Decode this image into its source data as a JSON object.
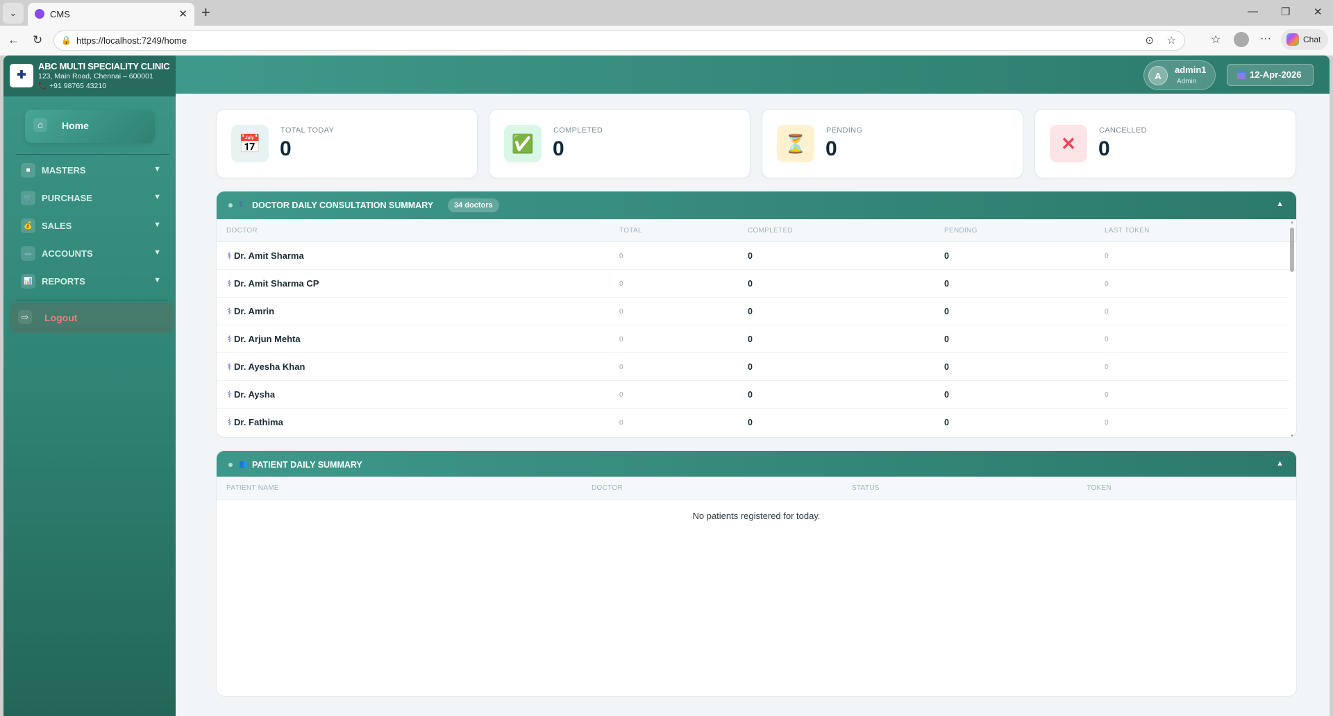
{
  "browser": {
    "tab_title": "CMS",
    "url": "https://localhost:7249/home",
    "chat_label": "Chat"
  },
  "clinic": {
    "name": "ABC MULTI SPECIALITY CLINIC",
    "address": "123, Main Road, Chennai – 600001",
    "phone": "+91 98765 43210"
  },
  "sidebar": {
    "home": "Home",
    "items": [
      {
        "label": "MASTERS",
        "icon": "folder-icon"
      },
      {
        "label": "PURCHASE",
        "icon": "cart-icon"
      },
      {
        "label": "SALES",
        "icon": "money-bag-icon"
      },
      {
        "label": "ACCOUNTS",
        "icon": "credit-card-icon"
      },
      {
        "label": "REPORTS",
        "icon": "bar-chart-icon"
      }
    ],
    "logout": "Logout"
  },
  "header": {
    "user_initial": "A",
    "user_name": "admin1",
    "user_role": "Admin",
    "date": "12-Apr-2026"
  },
  "stats": [
    {
      "label": "TOTAL TODAY",
      "value": "0",
      "icon": "calendar-icon"
    },
    {
      "label": "COMPLETED",
      "value": "0",
      "icon": "check-icon"
    },
    {
      "label": "PENDING",
      "value": "0",
      "icon": "hourglass-icon"
    },
    {
      "label": "CANCELLED",
      "value": "0",
      "icon": "cross-icon"
    }
  ],
  "doctor_summary": {
    "title": "DOCTOR DAILY CONSULTATION SUMMARY",
    "badge": "34 doctors",
    "columns": [
      "DOCTOR",
      "TOTAL",
      "COMPLETED",
      "PENDING",
      "LAST TOKEN"
    ],
    "rows": [
      {
        "doctor": "Dr. Amit Sharma",
        "total": "0",
        "completed": "0",
        "pending": "0",
        "last_token": "0"
      },
      {
        "doctor": "Dr. Amit Sharma CP",
        "total": "0",
        "completed": "0",
        "pending": "0",
        "last_token": "0"
      },
      {
        "doctor": "Dr. Amrin",
        "total": "0",
        "completed": "0",
        "pending": "0",
        "last_token": "0"
      },
      {
        "doctor": "Dr. Arjun Mehta",
        "total": "0",
        "completed": "0",
        "pending": "0",
        "last_token": "0"
      },
      {
        "doctor": "Dr. Ayesha Khan",
        "total": "0",
        "completed": "0",
        "pending": "0",
        "last_token": "0"
      },
      {
        "doctor": "Dr. Aysha",
        "total": "0",
        "completed": "0",
        "pending": "0",
        "last_token": "0"
      },
      {
        "doctor": "Dr. Fathima",
        "total": "0",
        "completed": "0",
        "pending": "0",
        "last_token": "0"
      }
    ]
  },
  "patient_summary": {
    "title": "PATIENT DAILY SUMMARY",
    "columns": [
      "PATIENT NAME",
      "DOCTOR",
      "STATUS",
      "TOKEN"
    ],
    "empty_message": "No patients registered for today."
  }
}
